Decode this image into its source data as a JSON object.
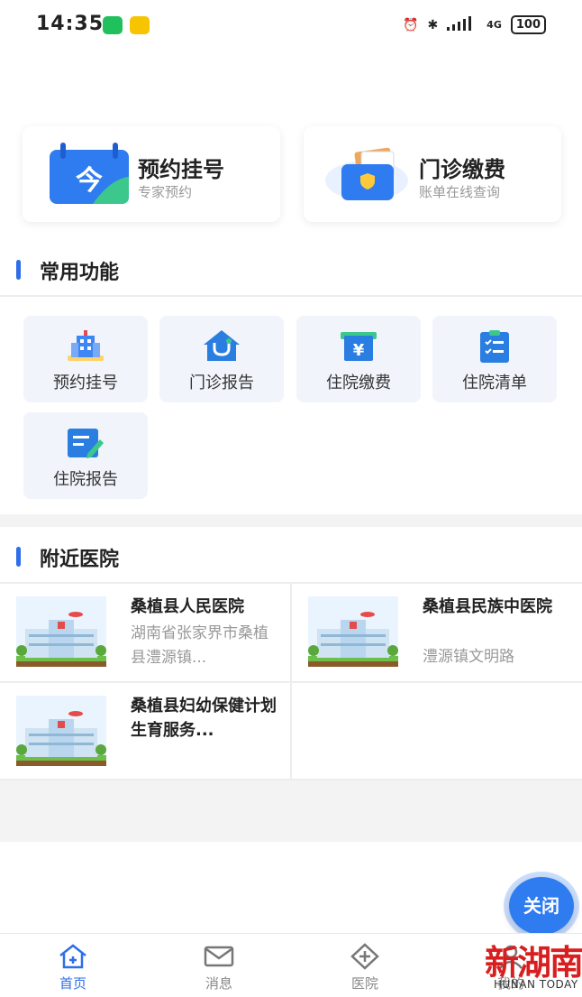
{
  "status_bar": {
    "time": "14:35",
    "battery": "100",
    "network": "4G"
  },
  "top_cards": [
    {
      "title": "预约挂号",
      "subtitle": "专家预约",
      "icon": "calendar-icon"
    },
    {
      "title": "门诊缴费",
      "subtitle": "账单在线查询",
      "icon": "wallet-icon"
    }
  ],
  "common": {
    "title": "常用功能",
    "items": [
      {
        "label": "预约挂号",
        "icon": "hospital-building-icon"
      },
      {
        "label": "门诊报告",
        "icon": "stethoscope-house-icon"
      },
      {
        "label": "住院缴费",
        "icon": "payment-icon"
      },
      {
        "label": "住院清单",
        "icon": "checklist-icon"
      },
      {
        "label": "住院报告",
        "icon": "report-edit-icon"
      }
    ]
  },
  "nearby": {
    "title": "附近医院",
    "hospitals": [
      {
        "name": "桑植县人民医院",
        "address": "湖南省张家界市桑植县澧源镇..."
      },
      {
        "name": "桑植县民族中医院",
        "address": "澧源镇文明路"
      },
      {
        "name": "桑植县妇幼保健计划生育服务...",
        "address": ""
      }
    ]
  },
  "fab": {
    "label": "关闭"
  },
  "bottom_nav": [
    {
      "label": "首页",
      "icon": "home-icon",
      "active": true
    },
    {
      "label": "消息",
      "icon": "mail-icon",
      "active": false
    },
    {
      "label": "医院",
      "icon": "medical-cross-icon",
      "active": false
    },
    {
      "label": "我的",
      "icon": "user-icon",
      "active": false
    }
  ],
  "watermark": {
    "logo": "新湖南",
    "text": "HUNAN TODAY"
  },
  "colors": {
    "accent": "#2f6ee8",
    "tile_bg": "#f1f5fb",
    "muted": "#999999"
  }
}
